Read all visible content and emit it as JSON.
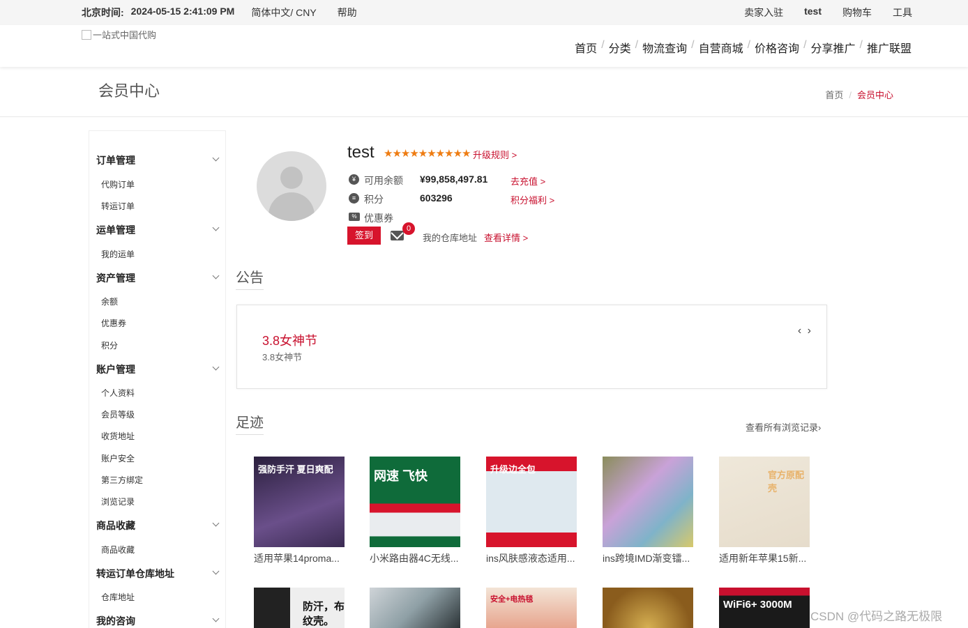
{
  "topbar": {
    "time_label": "北京时间:",
    "time_value": "2024-05-15 2:41:09 PM",
    "lang": "简体中文/ CNY",
    "help": "帮助",
    "right": [
      "卖家入驻",
      "test",
      "购物车",
      "工具"
    ]
  },
  "header": {
    "logo_alt": "一站式中国代购",
    "nav": [
      "首页",
      "分类",
      "物流查询",
      "自营商城",
      "价格咨询",
      "分享推广",
      "推广联盟"
    ]
  },
  "page_title": "会员中心",
  "breadcrumb": {
    "home": "首页",
    "current": "会员中心"
  },
  "sidebar": {
    "groups": [
      {
        "label": "订单管理",
        "items": [
          "代购订单",
          "转运订单"
        ]
      },
      {
        "label": "运单管理",
        "items": [
          "我的运单"
        ]
      },
      {
        "label": "资产管理",
        "items": [
          "余额",
          "优惠券",
          "积分"
        ]
      },
      {
        "label": "账户管理",
        "items": [
          "个人资料",
          "会员等级",
          "收货地址",
          "账户安全",
          "第三方绑定",
          "浏览记录"
        ]
      },
      {
        "label": "商品收藏",
        "items": [
          "商品收藏"
        ]
      },
      {
        "label": "转运订单仓库地址",
        "items": [
          "仓库地址"
        ]
      },
      {
        "label": "我的咨询",
        "items": []
      }
    ]
  },
  "profile": {
    "username": "test",
    "stars": "★★★★★★★★★★",
    "upgrade_link": "升级规则 >",
    "balance_label": "可用余额",
    "balance_value": "¥99,858,497.81",
    "recharge_link": "去充值 >",
    "points_label": "积分",
    "points_value": "603296",
    "points_link": "积分福利 >",
    "coupon_label": "优惠券",
    "sign_button": "签到",
    "mail_count": "0",
    "warehouse_label": "我的仓库地址",
    "warehouse_link": "查看详情 >"
  },
  "notice": {
    "section_title": "公告",
    "title": "3.8女神节",
    "subtitle": "3.8女神节",
    "arrows": "‹ ›"
  },
  "footprints": {
    "section_title": "足迹",
    "all_link": "查看所有浏览记录›",
    "items": [
      {
        "caption": "适用苹果14proma...",
        "img_text": "强防手汗 夏日爽配"
      },
      {
        "caption": "小米路由器4C无线...",
        "img_text": "网速 飞快"
      },
      {
        "caption": "ins风肤感液态适用...",
        "img_text": "升级边全包"
      },
      {
        "caption": "ins跨境IMD渐变镭...",
        "img_text": ""
      },
      {
        "caption": "适用新年苹果15新...",
        "img_text": "官方原配壳"
      }
    ],
    "row2": [
      {
        "img_text": "防汗，布纹壳。"
      },
      {
        "img_text": ""
      },
      {
        "img_text": "安全+电热毯"
      },
      {
        "img_text": ""
      },
      {
        "img_text": "WiFi6+ 3000M"
      }
    ]
  },
  "watermark": "CSDN @代码之路无极限",
  "colors": {
    "accent": "#c8102e",
    "star": "#ee7c12"
  }
}
